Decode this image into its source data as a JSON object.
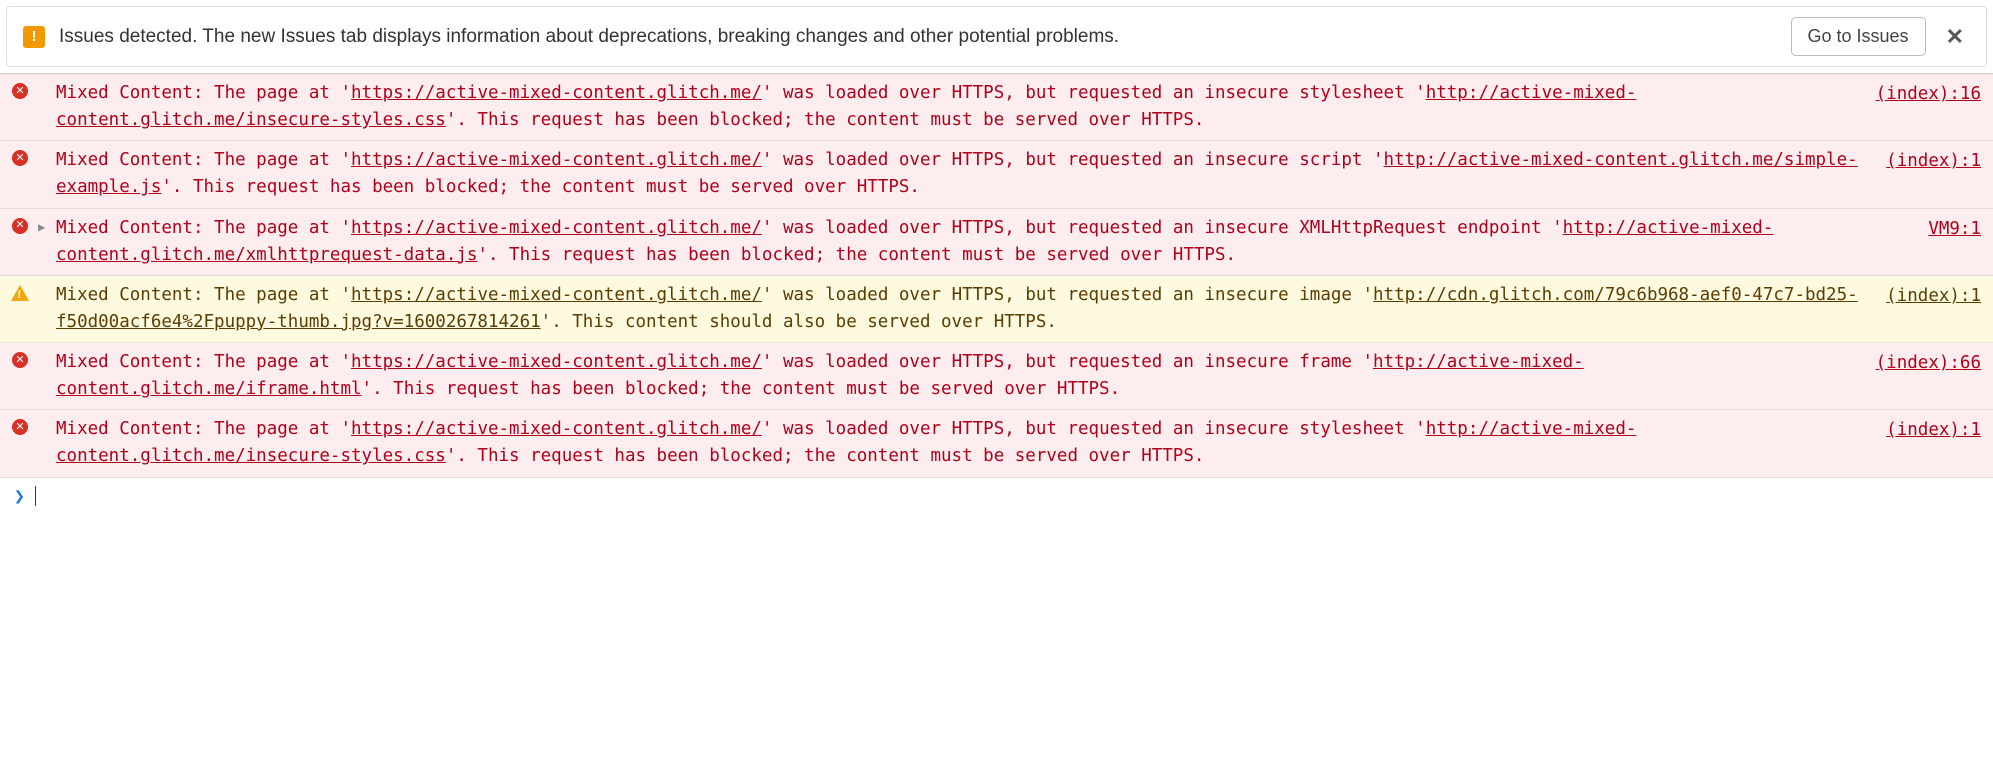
{
  "issuesBar": {
    "message": "Issues detected. The new Issues tab displays information about deprecations, breaking changes and other potential problems.",
    "buttonLabel": "Go to Issues",
    "badgeGlyph": "!"
  },
  "messages": [
    {
      "level": "error",
      "expandable": false,
      "source": "(index):16",
      "parts": [
        {
          "t": "text",
          "v": "Mixed Content: The page at '"
        },
        {
          "t": "url",
          "v": "https://active-mixed-content.glitch.me/"
        },
        {
          "t": "text",
          "v": "' was loaded over HTTPS, but requested an insecure stylesheet '"
        },
        {
          "t": "url",
          "v": "http://active-mixed-content.glitch.me/insecure-styles.css"
        },
        {
          "t": "text",
          "v": "'. This request has been blocked; the content must be served over HTTPS."
        }
      ]
    },
    {
      "level": "error",
      "expandable": false,
      "source": "(index):1",
      "parts": [
        {
          "t": "text",
          "v": "Mixed Content: The page at '"
        },
        {
          "t": "url",
          "v": "https://active-mixed-content.glitch.me/"
        },
        {
          "t": "text",
          "v": "' was loaded over HTTPS, but requested an insecure script '"
        },
        {
          "t": "url",
          "v": "http://active-mixed-content.glitch.me/simple-example.js"
        },
        {
          "t": "text",
          "v": "'. This request has been blocked; the content must be served over HTTPS."
        }
      ]
    },
    {
      "level": "error",
      "expandable": true,
      "source": "VM9:1",
      "parts": [
        {
          "t": "text",
          "v": "Mixed Content: The page at '"
        },
        {
          "t": "url",
          "v": "https://active-mixed-content.glitch.me/"
        },
        {
          "t": "text",
          "v": "' was loaded over HTTPS, but requested an insecure XMLHttpRequest endpoint '"
        },
        {
          "t": "url",
          "v": "http://active-mixed-content.glitch.me/xmlhttprequest-data.js"
        },
        {
          "t": "text",
          "v": "'. This request has been blocked; the content must be served over HTTPS."
        }
      ]
    },
    {
      "level": "warning",
      "expandable": false,
      "source": "(index):1",
      "parts": [
        {
          "t": "text",
          "v": "Mixed Content: The page at '"
        },
        {
          "t": "url",
          "v": "https://active-mixed-content.glitch.me/"
        },
        {
          "t": "text",
          "v": "' was loaded over HTTPS, but requested an insecure image '"
        },
        {
          "t": "url",
          "v": "http://cdn.glitch.com/79c6b968-aef0-47c7-bd25-f50d00acf6e4%2Fpuppy-thumb.jpg?v=1600267814261"
        },
        {
          "t": "text",
          "v": "'. This content should also be served over HTTPS."
        }
      ]
    },
    {
      "level": "error",
      "expandable": false,
      "source": "(index):66",
      "parts": [
        {
          "t": "text",
          "v": "Mixed Content: The page at '"
        },
        {
          "t": "url",
          "v": "https://active-mixed-content.glitch.me/"
        },
        {
          "t": "text",
          "v": "' was loaded over HTTPS, but requested an insecure frame '"
        },
        {
          "t": "url",
          "v": "http://active-mixed-content.glitch.me/iframe.html"
        },
        {
          "t": "text",
          "v": "'. This request has been blocked; the content must be served over HTTPS."
        }
      ]
    },
    {
      "level": "error",
      "expandable": false,
      "source": "(index):1",
      "parts": [
        {
          "t": "text",
          "v": "Mixed Content: The page at '"
        },
        {
          "t": "url",
          "v": "https://active-mixed-content.glitch.me/"
        },
        {
          "t": "text",
          "v": "' was loaded over HTTPS, but requested an insecure stylesheet '"
        },
        {
          "t": "url",
          "v": "http://active-mixed-content.glitch.me/insecure-styles.css"
        },
        {
          "t": "text",
          "v": "'. This request has been blocked; the content must be served over HTTPS."
        }
      ]
    }
  ],
  "prompt": {
    "chevron": "❯"
  }
}
